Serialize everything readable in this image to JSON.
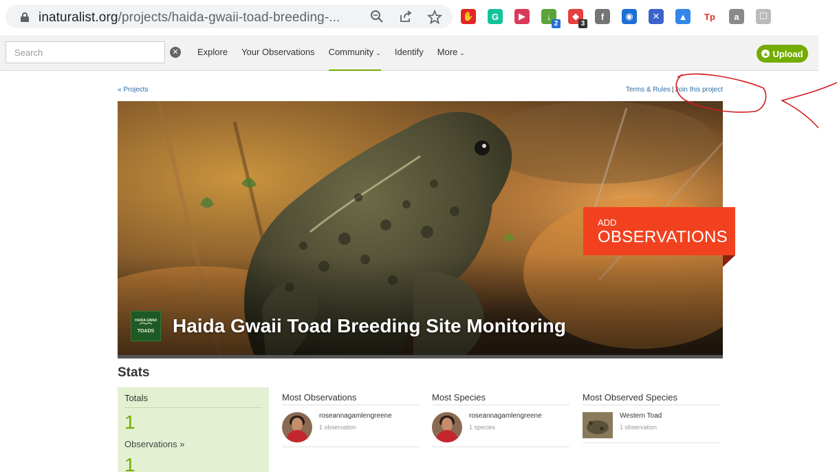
{
  "browser": {
    "url_host": "inaturalist.org",
    "url_path": "/projects/haida-gwaii-toad-breeding-...",
    "extensions": [
      {
        "name": "stop-ext-icon",
        "label": "✋",
        "color": "#e32626"
      },
      {
        "name": "grammarly-ext-icon",
        "label": "G",
        "color": "#15c39a"
      },
      {
        "name": "media-ext-icon",
        "label": "▶",
        "color": "#d93a5a"
      },
      {
        "name": "download-ext-icon",
        "label": "↓",
        "color": "#5aa43a",
        "badge": "2",
        "badge_color": "#2a6fd1"
      },
      {
        "name": "shield-ext-icon",
        "label": "◆",
        "color": "#e64040",
        "badge": "3",
        "badge_color": "#333333"
      },
      {
        "name": "facebook-ext-icon",
        "label": "f",
        "color": "#757575"
      },
      {
        "name": "chat-ext-icon",
        "label": "◉",
        "color": "#1d6fd6"
      },
      {
        "name": "puzzle-ext-icon",
        "label": "✕",
        "color": "#3b63c9"
      },
      {
        "name": "graduation-ext-icon",
        "label": "▲",
        "color": "#3387e8"
      },
      {
        "name": "tp-ext-icon",
        "label": "Tp",
        "color": "#ffffff",
        "text_color": "#e4302a"
      },
      {
        "name": "a-ext-icon",
        "label": "a",
        "color": "#8a8a8a"
      },
      {
        "name": "profile-ext-icon",
        "label": "☐",
        "color": "#bbbbbb"
      }
    ]
  },
  "nav": {
    "search_placeholder": "Search",
    "links": [
      "Explore",
      "Your Observations",
      "Community",
      "Identify",
      "More"
    ],
    "upload_label": "Upload"
  },
  "breadcrumb": "« Projects",
  "top_links": {
    "terms": "Terms & Rules",
    "join": "Join this project"
  },
  "hero": {
    "title": "Haida Gwaii Toad Breeding Site Monitoring",
    "project_icon_top": "HAIDA GWAII",
    "project_icon_bottom": "TOADS",
    "cta_small": "ADD",
    "cta_big": "OBSERVATIONS"
  },
  "stats": {
    "heading": "Stats",
    "totals_heading": "Totals",
    "observations_count": "1",
    "observations_label": "Observations »",
    "species_count": "1",
    "columns": [
      {
        "heading": "Most Observations",
        "name": "roseannagamlengreene",
        "sub": "1 observation"
      },
      {
        "heading": "Most Species",
        "name": "roseannagamlengreene",
        "sub": "1 species"
      },
      {
        "heading": "Most Observed Species",
        "name": "Western Toad",
        "sub": "1 observation"
      }
    ]
  }
}
